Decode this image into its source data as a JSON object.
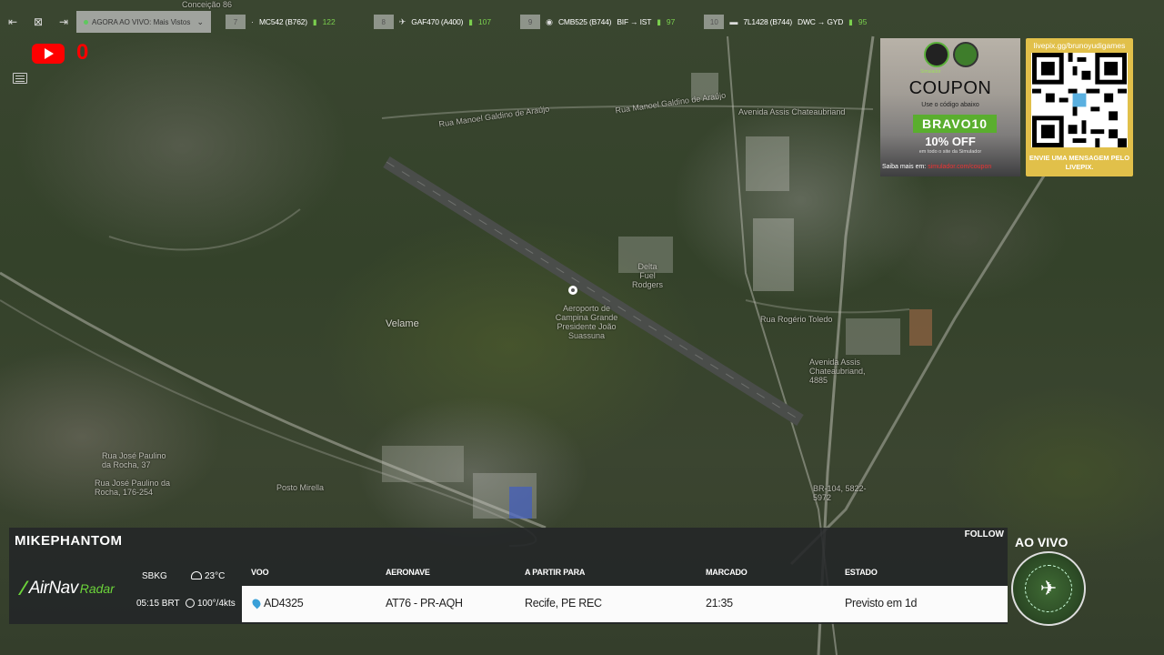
{
  "colors": {
    "accent_green": "#6cd43a",
    "youtube_red": "#ff0000",
    "qr_gold": "#e1c04a"
  },
  "toolbar": {
    "live_label": "AGORA AO VIVO: Mais Vistos",
    "flights": [
      {
        "num": "7",
        "label": "MC542 (B762)",
        "battery": "122"
      },
      {
        "num": "8",
        "label": "GAF470 (A400)",
        "battery": "107"
      },
      {
        "num": "9",
        "label": "CMB525 (B744)",
        "route": "BIF → IST",
        "battery": "97"
      },
      {
        "num": "10",
        "label": "7L1428 (B744)",
        "route": "DWC → GYD",
        "battery": "95"
      }
    ]
  },
  "youtube": {
    "count": "0"
  },
  "map": {
    "labels": [
      "Rua Manoel Galdino de Araújo",
      "Rua Manoel Galdino de Araújo",
      "Avenida Assis Chateaubriand",
      "Delta Fuel Rodgers",
      "Aeroporto de Campina Grande Presidente João Suassuna",
      "Velame",
      "Rua Rogério Toledo",
      "Avenida Assis Chateaubriand, 4885",
      "Rua José Paulino da Rocha, 37",
      "Rua José Paulino da Rocha, 176-254",
      "Posto Mirella",
      "BR-104, 5822-5972",
      "Conceição 86"
    ]
  },
  "coupon": {
    "brand": "Simulador",
    "title": "COUPON",
    "small": "Use o código abaixo",
    "code": "BRAVO10",
    "off": "10% OFF",
    "note": "em todo o site da Simulador",
    "foot_label": "Saiba mais em:",
    "foot_link": "simulador.com/coupon"
  },
  "livepix": {
    "url": "livepix.gg/brunoyudigames",
    "message": "ENVIE UMA MENSAGEM PELO LIVEPIX."
  },
  "panel": {
    "streamer": "MIKEPHANTOM",
    "follow": "FOLLOW",
    "logo_main": "AirNav",
    "logo_sub": "Radar",
    "airport": "SBKG",
    "temperature": "23°C",
    "local_time": "05:15 BRT",
    "wind": "100°/4kts",
    "headers": {
      "flight": "VOO",
      "aircraft": "AERONAVE",
      "route": "A PARTIR PARA",
      "scheduled": "MARCADO",
      "status": "ESTADO"
    },
    "row": {
      "flight": "AD4325",
      "aircraft": "AT76 - PR-AQH",
      "route": "Recife, PE REC",
      "scheduled": "21:35",
      "status": "Previsto em 1d"
    }
  },
  "live": {
    "label": "AO VIVO"
  }
}
